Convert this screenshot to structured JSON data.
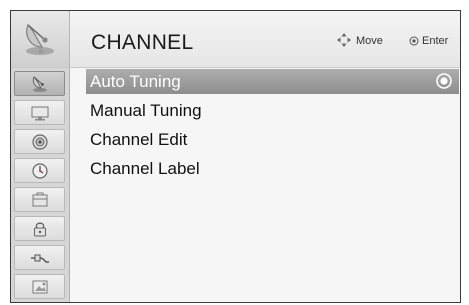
{
  "header": {
    "title": "CHANNEL",
    "icon": "satellite-dish-icon",
    "hints": [
      {
        "icon": "move-arrows-icon",
        "label": "Move"
      },
      {
        "icon": "enter-button-icon",
        "label": "Enter"
      }
    ]
  },
  "sidebar": {
    "items": [
      {
        "icon": "satellite-dish-icon",
        "active": true
      },
      {
        "icon": "tv-picture-icon",
        "active": false
      },
      {
        "icon": "speaker-audio-icon",
        "active": false
      },
      {
        "icon": "clock-time-icon",
        "active": false
      },
      {
        "icon": "option-toolbox-icon",
        "active": false
      },
      {
        "icon": "padlock-icon",
        "active": false
      },
      {
        "icon": "input-plug-icon",
        "active": false
      },
      {
        "icon": "usb-media-icon",
        "active": false
      }
    ]
  },
  "menu": {
    "items": [
      {
        "label": "Auto Tuning",
        "selected": true
      },
      {
        "label": "Manual Tuning",
        "selected": false
      },
      {
        "label": "Channel Edit",
        "selected": false
      },
      {
        "label": "Channel Label",
        "selected": false
      }
    ],
    "selected_indicator_icon": "radio-selected-icon"
  },
  "colors": {
    "selected_highlight": "#9b9b9b",
    "sidebar_bg": "#d6d6d6",
    "frame_border": "#3a3a3a"
  }
}
